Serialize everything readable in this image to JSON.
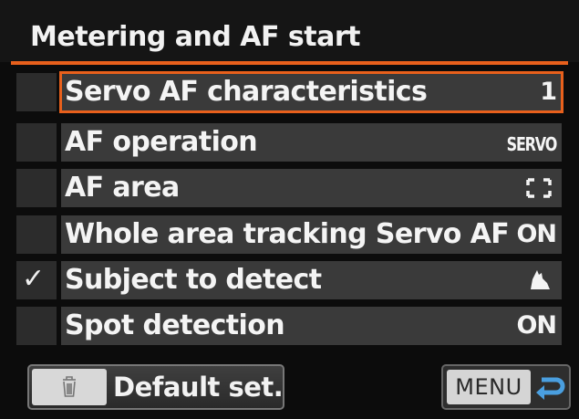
{
  "title": "Metering and AF start",
  "colors": {
    "accent": "#e8601c",
    "row_bg": "#3a3a3a",
    "check_bg": "#2c2c2c",
    "text": "#f4f4f4"
  },
  "items": [
    {
      "label": "Servo AF characteristics",
      "value": "1",
      "checked": false,
      "selected": true
    },
    {
      "label": "AF operation",
      "value": "SERVO",
      "checked": false,
      "selected": false
    },
    {
      "label": "AF area",
      "value": "",
      "value_icon": "af-area-bracket-icon",
      "checked": false,
      "selected": false
    },
    {
      "label": "Whole area tracking Servo AF",
      "value": "ON",
      "checked": false,
      "selected": false
    },
    {
      "label": "Subject to detect",
      "value": "",
      "value_icon": "animal-icon",
      "checked": true,
      "selected": false
    },
    {
      "label": "Spot detection",
      "value": "ON",
      "checked": false,
      "selected": false
    }
  ],
  "check_mark": "✓",
  "footer": {
    "default_label": "Default set.",
    "default_icon": "trash-icon",
    "menu_label": "MENU",
    "menu_icon": "return-arrow-icon"
  }
}
